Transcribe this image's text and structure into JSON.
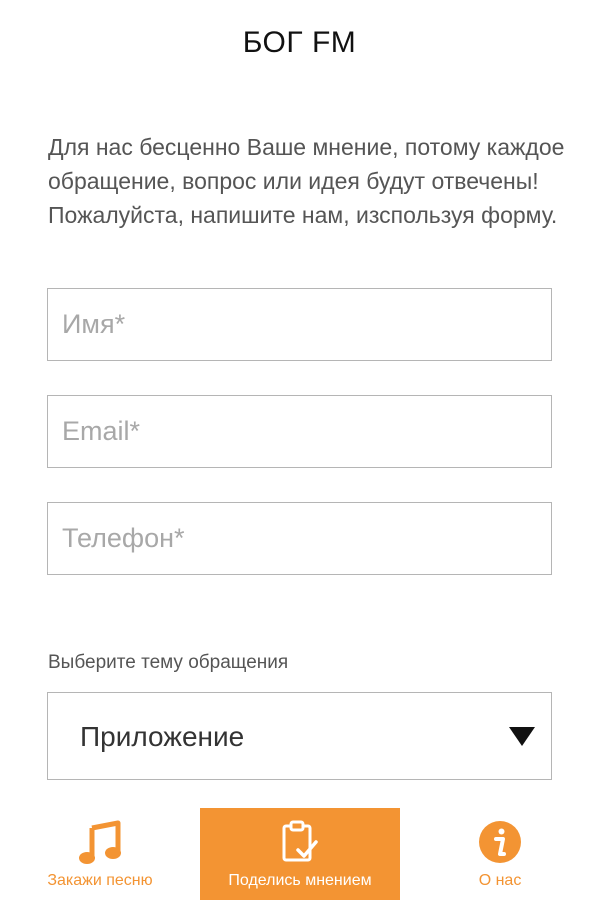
{
  "header": {
    "title": "БОГ FM"
  },
  "intro": "Для нас бесценно Ваше мнение, потому каждое обращение, вопрос или идея будут отвечены! Пожалуйста, напишите нам, изспользуя форму.",
  "form": {
    "name_placeholder": "Имя*",
    "email_placeholder": "Email*",
    "phone_placeholder": "Телефон*",
    "topic_label": "Выберите тему обращения",
    "topic_value": "Приложение"
  },
  "tabbar": {
    "items": [
      {
        "label": "Закажи песню",
        "icon": "music-note-icon",
        "active": false
      },
      {
        "label": "Поделись мнением",
        "icon": "clipboard-check-icon",
        "active": true
      },
      {
        "label": "О нас",
        "icon": "info-icon",
        "active": false
      }
    ]
  },
  "colors": {
    "accent": "#f39433",
    "text": "#555555",
    "border": "#b5b5b5"
  }
}
